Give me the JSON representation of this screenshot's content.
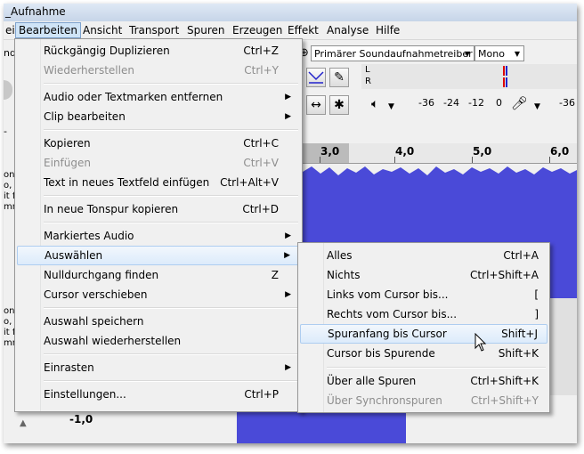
{
  "window": {
    "title": "_Aufnahme"
  },
  "menubar": [
    {
      "label": "ei"
    },
    {
      "label": "Bearbeiten"
    },
    {
      "label": "Ansicht"
    },
    {
      "label": "Transport"
    },
    {
      "label": "Spuren"
    },
    {
      "label": "Erzeugen"
    },
    {
      "label": "Effekt"
    },
    {
      "label": "Analyse"
    },
    {
      "label": "Hilfe"
    }
  ],
  "toolbar": {
    "host_fragment": "nde",
    "recording_device": "Primärer Soundaufnahmetreiber",
    "channels": "Mono",
    "meter_l": "L",
    "meter_r": "R",
    "meter_scale": [
      "-36",
      "-24",
      "-12",
      "0",
      "-36"
    ]
  },
  "ruler": {
    "labels": [
      "3,0",
      "4,0",
      "5,0",
      "6,0"
    ]
  },
  "track": {
    "info_upper": [
      "on",
      "o,",
      "it f",
      "mn"
    ],
    "info_lower": [
      "on",
      "o,",
      "it f",
      "mn"
    ],
    "bottom_value": "-1,0",
    "left_dash": "-"
  },
  "edit_menu": {
    "items": [
      {
        "label": "Rückgängig Duplizieren",
        "shortcut": "Ctrl+Z",
        "disabled": false
      },
      {
        "label": "Wiederherstellen",
        "shortcut": "Ctrl+Y",
        "disabled": true
      },
      {
        "label": "Audio oder Textmarken entfernen",
        "shortcut": "",
        "submenu": true
      },
      {
        "label": "Clip bearbeiten",
        "shortcut": "",
        "submenu": true
      },
      {
        "label": "Kopieren",
        "shortcut": "Ctrl+C"
      },
      {
        "label": "Einfügen",
        "shortcut": "Ctrl+V",
        "disabled": true
      },
      {
        "label": "Text in neues Textfeld einfügen",
        "shortcut": "Ctrl+Alt+V"
      },
      {
        "label": "In neue Tonspur kopieren",
        "shortcut": "Ctrl+D"
      },
      {
        "label": "Markiertes Audio",
        "shortcut": "",
        "submenu": true
      },
      {
        "label": "Auswählen",
        "shortcut": "",
        "submenu": true,
        "highlighted": true
      },
      {
        "label": "Nulldurchgang finden",
        "shortcut": "Z"
      },
      {
        "label": "Cursor verschieben",
        "shortcut": "",
        "submenu": true
      },
      {
        "label": "Auswahl speichern",
        "shortcut": ""
      },
      {
        "label": "Auswahl wiederherstellen",
        "shortcut": ""
      },
      {
        "label": "Einrasten",
        "shortcut": "",
        "submenu": true
      },
      {
        "label": "Einstellungen...",
        "shortcut": "Ctrl+P"
      }
    ]
  },
  "select_submenu": {
    "items": [
      {
        "label": "Alles",
        "shortcut": "Ctrl+A"
      },
      {
        "label": "Nichts",
        "shortcut": "Ctrl+Shift+A"
      },
      {
        "label": "Links vom Cursor bis...",
        "shortcut": "["
      },
      {
        "label": "Rechts vom Cursor bis...",
        "shortcut": "]"
      },
      {
        "label": "Spuranfang bis Cursor",
        "shortcut": "Shift+J",
        "highlighted": true
      },
      {
        "label": "Cursor bis Spurende",
        "shortcut": "Shift+K"
      },
      {
        "label": "Über alle Spuren",
        "shortcut": "Ctrl+Shift+K"
      },
      {
        "label": "Über Synchronspuren",
        "shortcut": "Ctrl+Shift+Y",
        "disabled": true
      }
    ]
  },
  "colors": {
    "waveform": "#4a4ad8",
    "menu_highlight": "#dcebfb",
    "disabled_text": "#8d8d8d"
  }
}
